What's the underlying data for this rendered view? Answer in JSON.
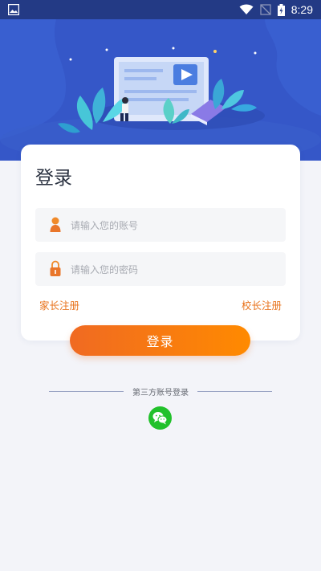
{
  "status_bar": {
    "time": "8:29"
  },
  "login_card": {
    "title": "登录",
    "account_placeholder": "请输入您的账号",
    "password_placeholder": "请输入您的密码",
    "parent_register_label": "家长注册",
    "principal_register_label": "校长注册"
  },
  "login_button_label": "登录",
  "third_party": {
    "label": "第三方账号登录",
    "wechat_icon": "wechat-icon"
  },
  "colors": {
    "accent": "#f37321",
    "hero_blue": "#3557c8",
    "wechat_green": "#21c12b"
  }
}
